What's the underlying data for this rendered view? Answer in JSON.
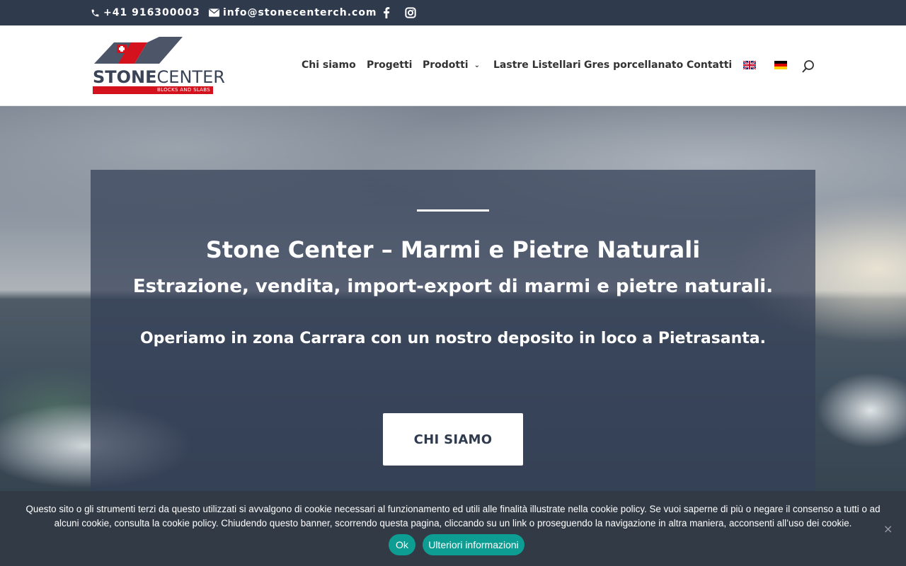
{
  "topbar": {
    "phone": "+41 916300003",
    "email": "info@stonecenterch.com",
    "social": [
      "facebook-icon",
      "instagram-icon"
    ]
  },
  "logo": {
    "word_bold": "STONE",
    "word_light": "CENTER",
    "tagline": "BLOCKS AND SLABS",
    "colors": {
      "brand_red": "#d4121e",
      "brand_slate": "#3a4456"
    }
  },
  "nav": {
    "items": [
      {
        "label": "Chi siamo"
      },
      {
        "label": "Progetti"
      },
      {
        "label": "Prodotti",
        "has_dropdown": true
      },
      {
        "label": "Lastre Listellari"
      },
      {
        "label": "Gres porcellanato"
      },
      {
        "label": "Contatti"
      }
    ],
    "languages": [
      "uk-flag-icon",
      "de-flag-icon"
    ],
    "search_icon": "search-icon"
  },
  "hero": {
    "title": "Stone Center – Marmi e Pietre Naturali",
    "subtitle": "Estrazione, vendita, import-export di marmi e pietre naturali.",
    "body": "Operiamo in zona Carrara con un nostro deposito in loco a Pietrasanta.",
    "cta": "CHI SIAMO"
  },
  "cookie": {
    "text": "Questo sito o gli strumenti terzi da questo utilizzati si avvalgono di cookie necessari al funzionamento ed utili alle finalità illustrate nella cookie policy. Se vuoi saperne di più o negare il consenso a tutti o ad alcuni cookie, consulta la cookie policy. Chiudendo questo banner, scorrendo questa pagina, cliccando su un link o proseguendo la navigazione in altra maniera, acconsenti all’uso dei cookie.",
    "ok": "Ok",
    "more": "Ulteriori informazioni",
    "close": "×",
    "accent": "#0e9d93"
  }
}
